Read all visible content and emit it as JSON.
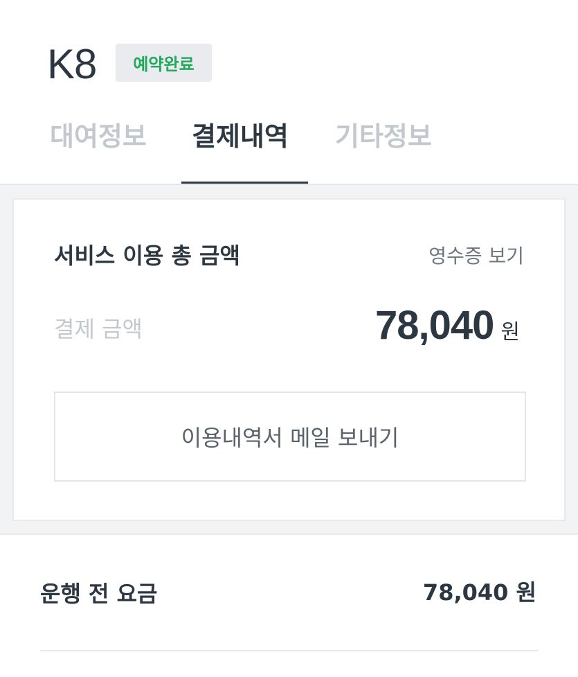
{
  "header": {
    "car_name": "K8",
    "status_badge": "예약완료"
  },
  "tabs": [
    {
      "label": "대여정보",
      "active": false
    },
    {
      "label": "결제내역",
      "active": true
    },
    {
      "label": "기타정보",
      "active": false
    }
  ],
  "summary": {
    "title": "서비스 이용 총 금액",
    "receipt_link": "영수증 보기",
    "amount_label": "결제 금액",
    "amount_value": "78,040",
    "amount_unit": "원",
    "email_button": "이용내역서 메일 보내기"
  },
  "fees": [
    {
      "label": "운행 전 요금",
      "value": "78,040 원"
    }
  ],
  "colors": {
    "status_green": "#1fa95b",
    "text_dark": "#2c3742",
    "text_muted": "#c3c8ce"
  }
}
